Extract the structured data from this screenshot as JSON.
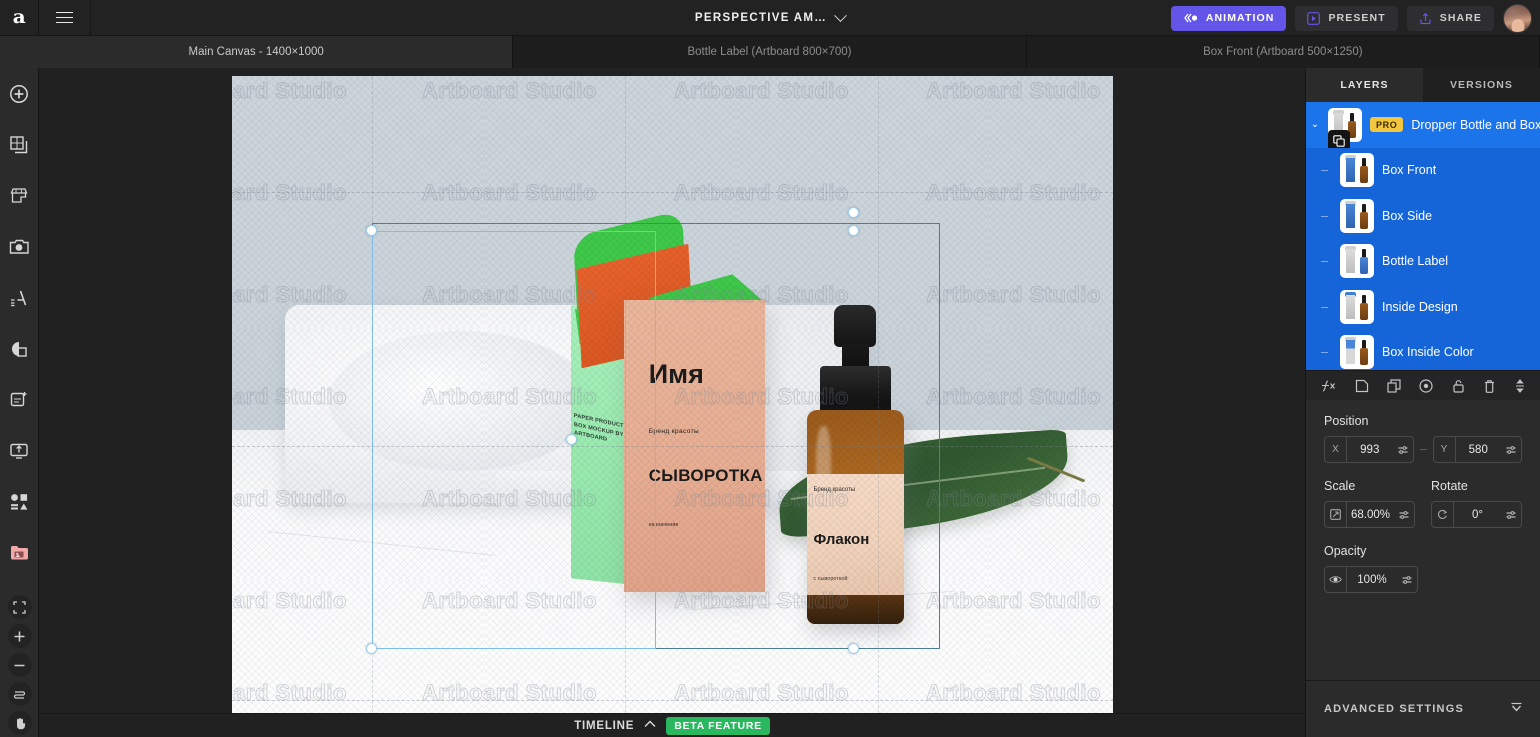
{
  "topbar": {
    "logo_icon": "artboard-studio-logo",
    "menu_icon": "hamburger-menu-icon",
    "document_title": "PERSPECTIVE AM…",
    "title_chevron_icon": "chevron-down-icon",
    "animation_label": "ANIMATION",
    "animation_icon": "animation-icon",
    "animation_color": "#6355e8",
    "present_label": "PRESENT",
    "present_icon": "play-icon",
    "share_label": "SHARE",
    "share_icon": "upload-icon",
    "avatar_name": "user-avatar"
  },
  "tabs": [
    {
      "label": "Main Canvas - 1400×1000",
      "active": true
    },
    {
      "label": "Bottle Label (Artboard 800×700)",
      "active": false
    },
    {
      "label": "Box Front (Artboard 500×1250)",
      "active": false
    }
  ],
  "left_rail": {
    "tools": [
      {
        "icon": "add-circle-icon"
      },
      {
        "icon": "templates-icon"
      },
      {
        "icon": "marketplace-icon"
      },
      {
        "icon": "camera-icon"
      },
      {
        "icon": "text-icon"
      },
      {
        "icon": "shapes-icon"
      },
      {
        "icon": "new-page-icon"
      },
      {
        "icon": "upload-screen-icon"
      },
      {
        "icon": "elements-icon"
      },
      {
        "icon": "my-assets-icon"
      }
    ],
    "zoom_tools": [
      {
        "icon": "fit-screen-icon"
      },
      {
        "icon": "zoom-in-icon"
      },
      {
        "icon": "zoom-out-icon"
      },
      {
        "icon": "reset-zoom-icon"
      },
      {
        "icon": "hand-tool-icon"
      }
    ]
  },
  "canvas": {
    "watermark_text": "Artboard Studio",
    "box": {
      "title": "Имя",
      "brand": "Бренд красоты",
      "subtitle": "СЫВОРОТКА",
      "small": "назначение",
      "side_text": "PAPER PRODUCT\nBOX MOCKUP\nBY ARTBOARD"
    },
    "bottle": {
      "brand": "Бренд красоты",
      "title": "Флакон",
      "small": "с сывороткой"
    }
  },
  "right_panel": {
    "tabs": [
      {
        "label": "LAYERS",
        "active": true
      },
      {
        "label": "VERSIONS",
        "active": false
      }
    ],
    "layers": [
      {
        "name": "Dropper Bottle and Box",
        "badge": "PRO",
        "parent": true,
        "thumb": "group-thumb"
      },
      {
        "name": "Box Front",
        "badge": "",
        "parent": false,
        "thumb": "box-front-thumb"
      },
      {
        "name": "Box Side",
        "badge": "",
        "parent": false,
        "thumb": "box-side-thumb"
      },
      {
        "name": "Bottle Label",
        "badge": "",
        "parent": false,
        "thumb": "bottle-label-thumb"
      },
      {
        "name": "Inside Design",
        "badge": "",
        "parent": false,
        "thumb": "inside-design-thumb"
      },
      {
        "name": "Box Inside Color",
        "badge": "",
        "parent": false,
        "thumb": "box-inside-thumb"
      }
    ],
    "layer_tools": [
      {
        "icon": "effects-fx-icon"
      },
      {
        "icon": "new-layer-icon"
      },
      {
        "icon": "duplicate-layer-icon"
      },
      {
        "icon": "mask-icon"
      },
      {
        "icon": "lock-icon"
      },
      {
        "icon": "delete-icon"
      },
      {
        "icon": "resize-handle-icon"
      }
    ],
    "position": {
      "label": "Position",
      "x_prefix": "X",
      "x_value": "993",
      "y_prefix": "Y",
      "y_value": "580"
    },
    "scale": {
      "label": "Scale",
      "icon": "scale-icon",
      "value": "68.00%"
    },
    "rotate": {
      "label": "Rotate",
      "icon": "rotate-icon",
      "value": "0°"
    },
    "opacity": {
      "label": "Opacity",
      "icon": "eye-icon",
      "value": "100%"
    },
    "advanced_settings": {
      "label": "ADVANCED SETTINGS",
      "chevron_icon": "chevron-down-double-icon"
    },
    "selected_color": "#1565d8",
    "badge_color": "#f3c63f"
  },
  "timeline": {
    "label": "TIMELINE",
    "chevron_icon": "chevron-up-icon",
    "beta_label": "BETA FEATURE",
    "beta_color": "#2ab85f"
  }
}
